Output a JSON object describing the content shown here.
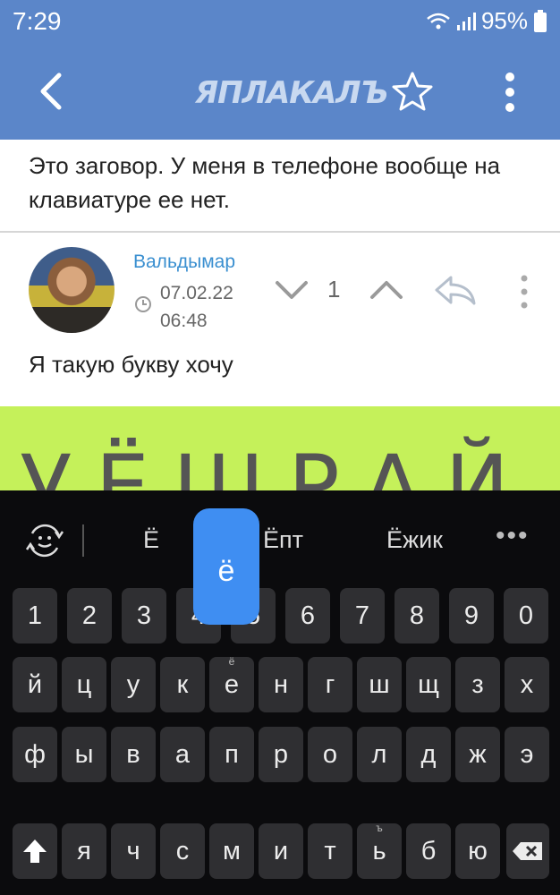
{
  "status": {
    "time": "7:29",
    "battery": "95%"
  },
  "app": {
    "title": "ЯПЛАКАЛЪ"
  },
  "post_previous": {
    "text": "Это заговор. У меня в телефоне вообще на клавиатуре ее нет."
  },
  "post": {
    "author": "Вальдымар",
    "date": "07.02.22",
    "time": "06:48",
    "score": "1",
    "text": "Я такую букву хочу",
    "image_text": "УЁШРАЙ"
  },
  "keyboard": {
    "suggestions": [
      "Ё",
      "Ёпт",
      "Ёжик"
    ],
    "more": "•••",
    "popup": "ё",
    "row1": [
      "1",
      "2",
      "3",
      "4",
      "5",
      "6",
      "7",
      "8",
      "9",
      "0"
    ],
    "row2": [
      "й",
      "ц",
      "у",
      "к",
      "е",
      "н",
      "г",
      "ш",
      "щ",
      "з",
      "х"
    ],
    "row2_hint": "ё",
    "row3": [
      "ф",
      "ы",
      "в",
      "а",
      "п",
      "р",
      "о",
      "л",
      "д",
      "ж",
      "э"
    ],
    "row4": [
      "я",
      "ч",
      "с",
      "м",
      "и",
      "т",
      "ь",
      "б",
      "ю"
    ],
    "row4_hint": "ъ"
  },
  "colors": {
    "header": "#5b86c9",
    "accent": "#3a8fd0",
    "popup": "#3f8ef2",
    "keyboard": "#0b0b0d"
  },
  "icons": [
    "back-icon",
    "star-icon",
    "more-vertical-icon",
    "clock-icon",
    "chevron-down-icon",
    "chevron-up-icon",
    "reply-icon",
    "emoji-cycle-icon",
    "shift-icon",
    "backspace-icon",
    "wifi-icon",
    "signal-icon",
    "battery-icon"
  ]
}
